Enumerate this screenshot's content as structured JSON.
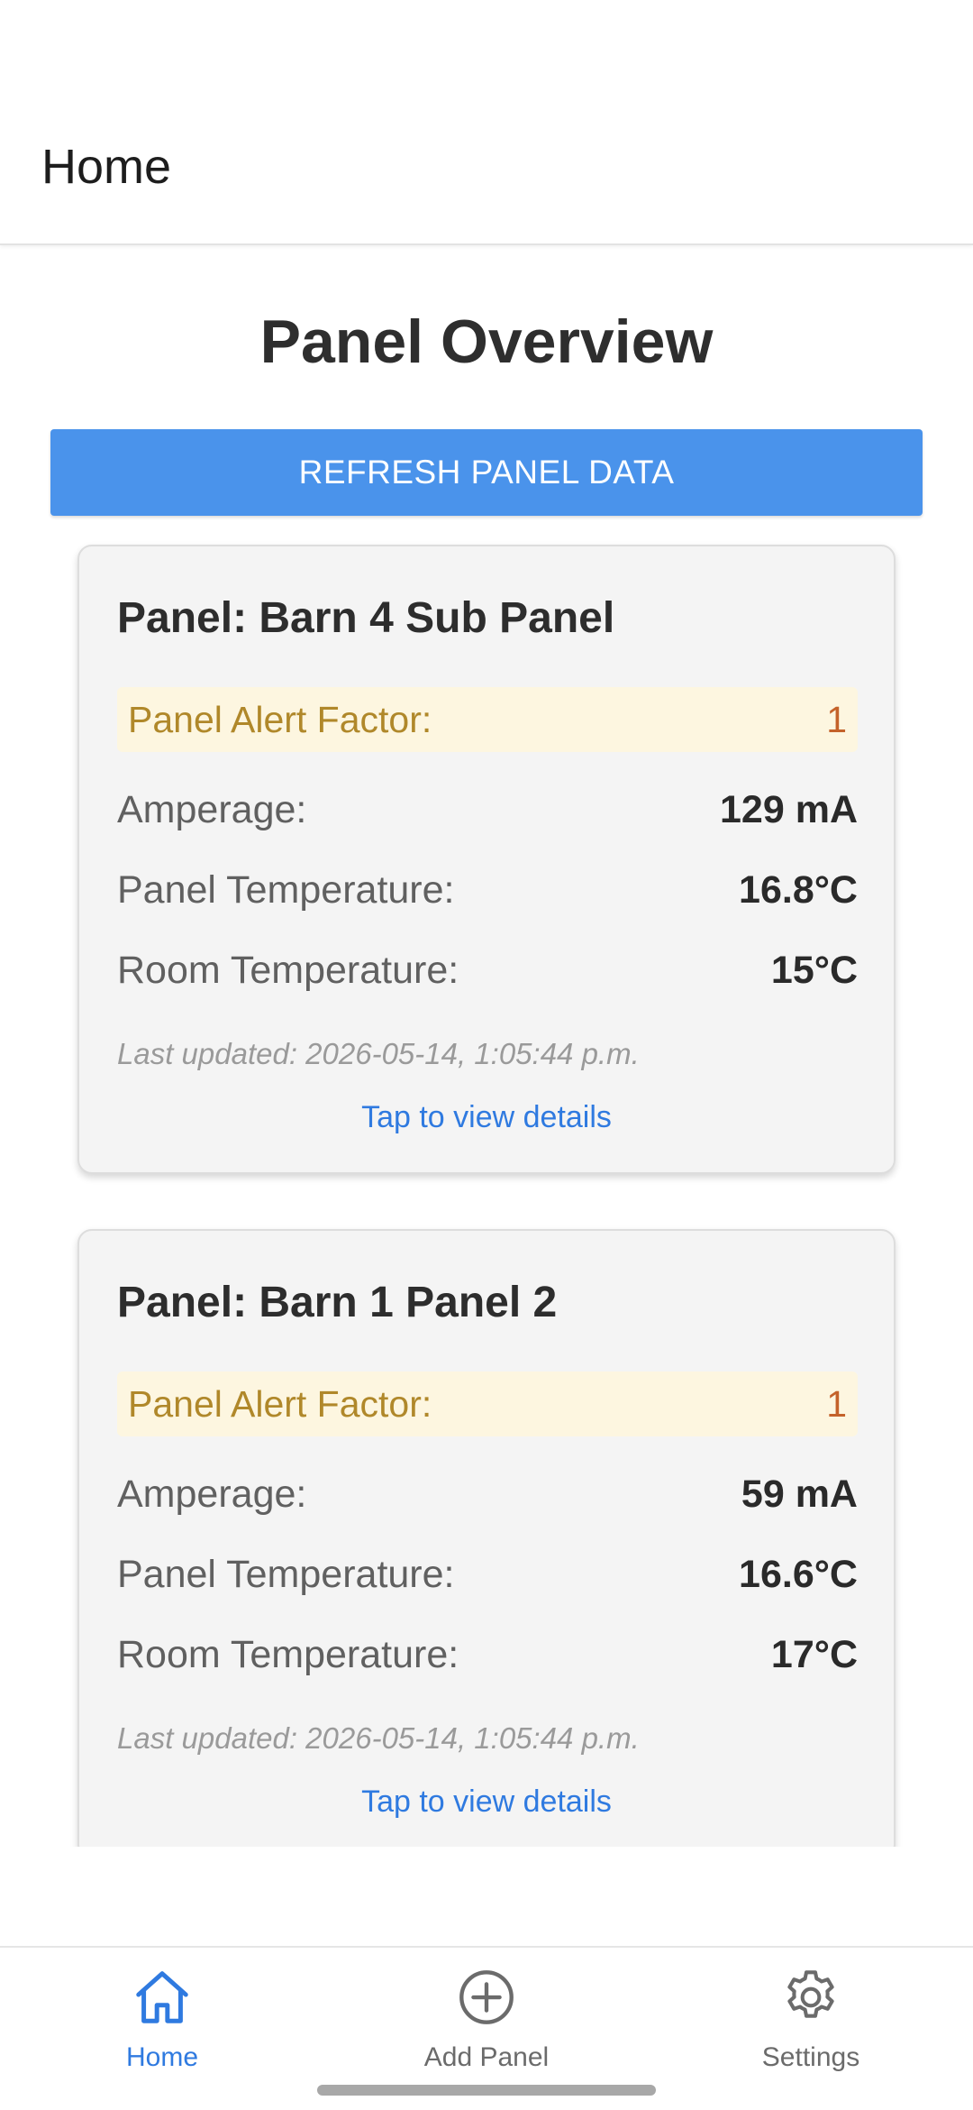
{
  "header": {
    "title": "Home"
  },
  "main": {
    "page_title": "Panel Overview",
    "refresh_label": "REFRESH PANEL DATA",
    "panels": [
      {
        "title": "Panel: Barn 4 Sub Panel",
        "alert_label": "Panel Alert Factor:",
        "alert_value": "1",
        "amperage_label": "Amperage:",
        "amperage_value": "129 mA",
        "panel_temp_label": "Panel Temperature:",
        "panel_temp_value": "16.8°C",
        "room_temp_label": "Room Temperature:",
        "room_temp_value": "15°C",
        "last_updated": "Last updated: 2026-05-14, 1:05:44 p.m.",
        "details_link": "Tap to view details"
      },
      {
        "title": "Panel: Barn 1 Panel 2",
        "alert_label": "Panel Alert Factor:",
        "alert_value": "1",
        "amperage_label": "Amperage:",
        "amperage_value": "59 mA",
        "panel_temp_label": "Panel Temperature:",
        "panel_temp_value": "16.6°C",
        "room_temp_label": "Room Temperature:",
        "room_temp_value": "17°C",
        "last_updated": "Last updated: 2026-05-14, 1:05:44 p.m.",
        "details_link": "Tap to view details"
      }
    ]
  },
  "bottom_nav": {
    "items": [
      {
        "label": "Home",
        "icon": "home-icon",
        "active": true
      },
      {
        "label": "Add Panel",
        "icon": "add-circle-icon",
        "active": false
      },
      {
        "label": "Settings",
        "icon": "gear-icon",
        "active": false
      }
    ]
  },
  "colors": {
    "accent": "#4a93eb",
    "link": "#2f7ae0",
    "alert_background": "#fdf6e0",
    "alert_label": "#b0882a",
    "alert_value": "#c4622a",
    "card_background": "#f4f4f4"
  }
}
